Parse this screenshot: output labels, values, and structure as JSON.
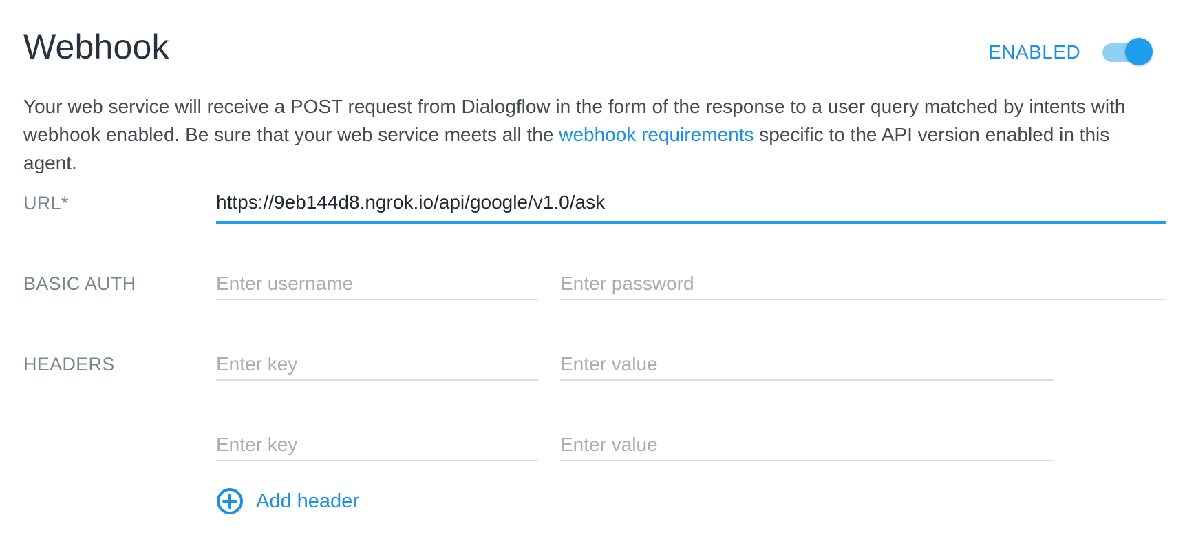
{
  "header": {
    "title": "Webhook",
    "status_label": "ENABLED",
    "toggle_on": true
  },
  "description": {
    "part1": "Your web service will receive a POST request from Dialogflow in the form of the response to a user query matched by intents with webhook enabled. Be sure that your web service meets all the ",
    "link_text": "webhook requirements",
    "part2": " specific to the API version enabled in this agent."
  },
  "url": {
    "label": "URL*",
    "value": "https://9eb144d8.ngrok.io/api/google/v1.0/ask"
  },
  "basic_auth": {
    "label": "BASIC AUTH",
    "username_placeholder": "Enter username",
    "password_placeholder": "Enter password"
  },
  "headers": {
    "label": "HEADERS",
    "rows": [
      {
        "key_placeholder": "Enter key",
        "value_placeholder": "Enter value"
      },
      {
        "key_placeholder": "Enter key",
        "value_placeholder": "Enter value"
      }
    ],
    "add_label": "Add header"
  },
  "colors": {
    "accent": "#1e9fee",
    "link": "#1f8fe0",
    "title": "#2a3240",
    "label": "#7b8591",
    "placeholder": "#a9aeb3"
  },
  "icons": {
    "add": "add-circle-icon"
  }
}
